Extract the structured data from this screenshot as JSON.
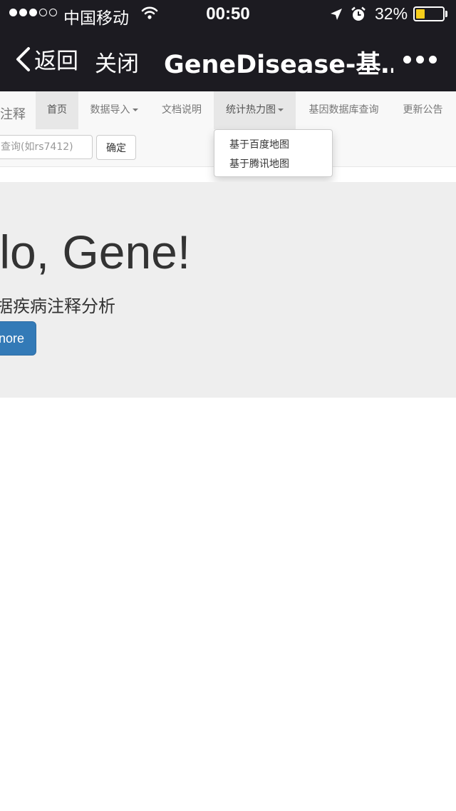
{
  "status_bar": {
    "carrier": "中国移动",
    "time": "00:50",
    "battery_percent": "32%",
    "battery_level": 0.32,
    "signal_bars_filled": 3,
    "signal_bars_total": 5,
    "icons": [
      "signal-dots-icon",
      "wifi-icon",
      "location-arrow-icon",
      "alarm-icon",
      "battery-icon"
    ]
  },
  "nav": {
    "back_label": "返回",
    "close_label": "关闭",
    "title": "GeneDisease-基…",
    "more_icon": "more-dots-icon"
  },
  "menu": {
    "brand": "注释",
    "items": [
      {
        "label": "首页",
        "active": true
      },
      {
        "label": "数据导入",
        "dropdown": true
      },
      {
        "label": "文档说明"
      },
      {
        "label": "统计热力图",
        "dropdown": true,
        "open": true
      },
      {
        "label": "基因数据库查询"
      },
      {
        "label": "更新公告"
      }
    ],
    "search": {
      "placeholder": "查询(如rs7412)",
      "value": ""
    },
    "confirm_label": "确定"
  },
  "dropdown": {
    "items": [
      "基于百度地图",
      "基于腾讯地图"
    ]
  },
  "jumbotron": {
    "title": "ello, Gene!",
    "subtitle": "据疾病注释分析",
    "button_label": "nore"
  },
  "colors": {
    "bar_background": "#1c1b21",
    "menu_background": "#f8f8f8",
    "jumbotron_background": "#eeeeee",
    "primary_button": "#337ab7",
    "battery_fill": "#f7ce1b"
  }
}
